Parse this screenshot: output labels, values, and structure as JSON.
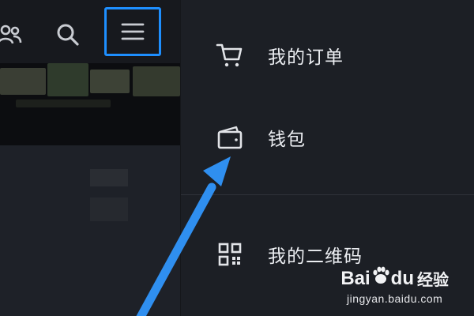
{
  "drawer": {
    "items": [
      {
        "label": "我的订单",
        "icon": "cart-icon"
      },
      {
        "label": "钱包",
        "icon": "wallet-icon"
      },
      {
        "label": "我的二维码",
        "icon": "qr-code-icon"
      }
    ]
  },
  "toolbar": {
    "icons": [
      "friends-icon",
      "search-icon",
      "menu-icon"
    ]
  },
  "colors": {
    "drawer_bg": "#1c1f25",
    "highlight": "#1e8fff",
    "arrow": "#2f8ff0",
    "text": "#eceef2"
  },
  "watermark": {
    "logo_text_left": "Bai",
    "logo_text_right": "du",
    "logo_cn": "经验",
    "url": "jingyan.baidu.com"
  }
}
